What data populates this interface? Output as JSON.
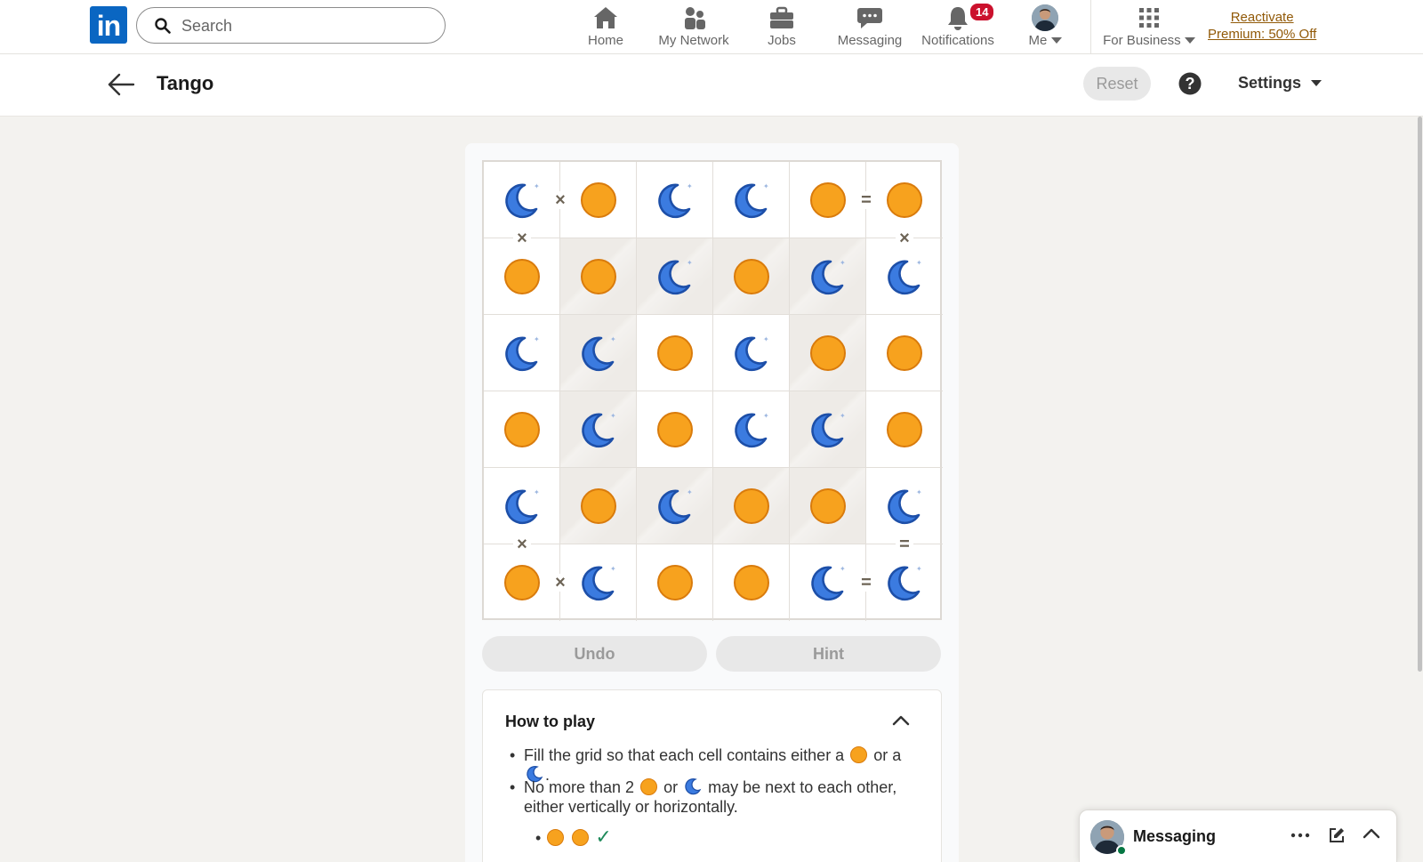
{
  "nav": {
    "logo_text": "in",
    "search_placeholder": "Search",
    "items": [
      {
        "label": "Home",
        "icon": "home-icon"
      },
      {
        "label": "My Network",
        "icon": "network-icon"
      },
      {
        "label": "Jobs",
        "icon": "briefcase-icon"
      },
      {
        "label": "Messaging",
        "icon": "chat-icon"
      },
      {
        "label": "Notifications",
        "icon": "bell-icon",
        "badge": "14"
      },
      {
        "label": "Me",
        "icon": "avatar"
      },
      {
        "label": "For Business",
        "icon": "grid-icon"
      }
    ],
    "premium_line1": "Reactivate",
    "premium_line2": "Premium: 50% Off"
  },
  "header": {
    "title": "Tango",
    "reset_label": "Reset",
    "settings_label": "Settings"
  },
  "board": {
    "size": 6,
    "rows": [
      [
        "moon",
        "sun",
        "moon",
        "moon",
        "sun",
        "sun"
      ],
      [
        "sun",
        "sun",
        "moon",
        "sun",
        "moon",
        "moon"
      ],
      [
        "moon",
        "moon",
        "sun",
        "moon",
        "sun",
        "sun"
      ],
      [
        "sun",
        "moon",
        "sun",
        "moon",
        "moon",
        "sun"
      ],
      [
        "moon",
        "sun",
        "moon",
        "sun",
        "sun",
        "moon"
      ],
      [
        "sun",
        "moon",
        "sun",
        "sun",
        "moon",
        "moon"
      ]
    ],
    "shaded": [
      [
        1,
        1
      ],
      [
        1,
        2
      ],
      [
        1,
        3
      ],
      [
        1,
        4
      ],
      [
        2,
        1
      ],
      [
        2,
        4
      ],
      [
        3,
        1
      ],
      [
        3,
        4
      ],
      [
        4,
        1
      ],
      [
        4,
        2
      ],
      [
        4,
        3
      ],
      [
        4,
        4
      ]
    ],
    "constraints": [
      {
        "type": "×",
        "cell": [
          0,
          0
        ],
        "dir": "right"
      },
      {
        "type": "=",
        "cell": [
          0,
          4
        ],
        "dir": "right"
      },
      {
        "type": "×",
        "cell": [
          0,
          0
        ],
        "dir": "down"
      },
      {
        "type": "×",
        "cell": [
          0,
          5
        ],
        "dir": "down"
      },
      {
        "type": "×",
        "cell": [
          4,
          0
        ],
        "dir": "down"
      },
      {
        "type": "=",
        "cell": [
          4,
          5
        ],
        "dir": "down"
      },
      {
        "type": "×",
        "cell": [
          5,
          0
        ],
        "dir": "right"
      },
      {
        "type": "=",
        "cell": [
          5,
          4
        ],
        "dir": "right"
      }
    ]
  },
  "controls": {
    "undo_label": "Undo",
    "hint_label": "Hint"
  },
  "how_to_play": {
    "heading": "How to play",
    "rule1_prefix": "Fill the grid so that each cell contains either a",
    "rule1_mid": "or a",
    "rule1_end": ".",
    "rule2_prefix": "No more than 2",
    "rule2_mid": "or",
    "rule2_suffix": "may be next to each other, either vertically or horizontally.",
    "example_check": "✓"
  },
  "messaging": {
    "label": "Messaging"
  },
  "colors": {
    "brand": "#0a66c2",
    "sun": "#f7a21e",
    "moon": "#2f6fd6",
    "badge": "#cb112d",
    "premium": "#915907"
  }
}
